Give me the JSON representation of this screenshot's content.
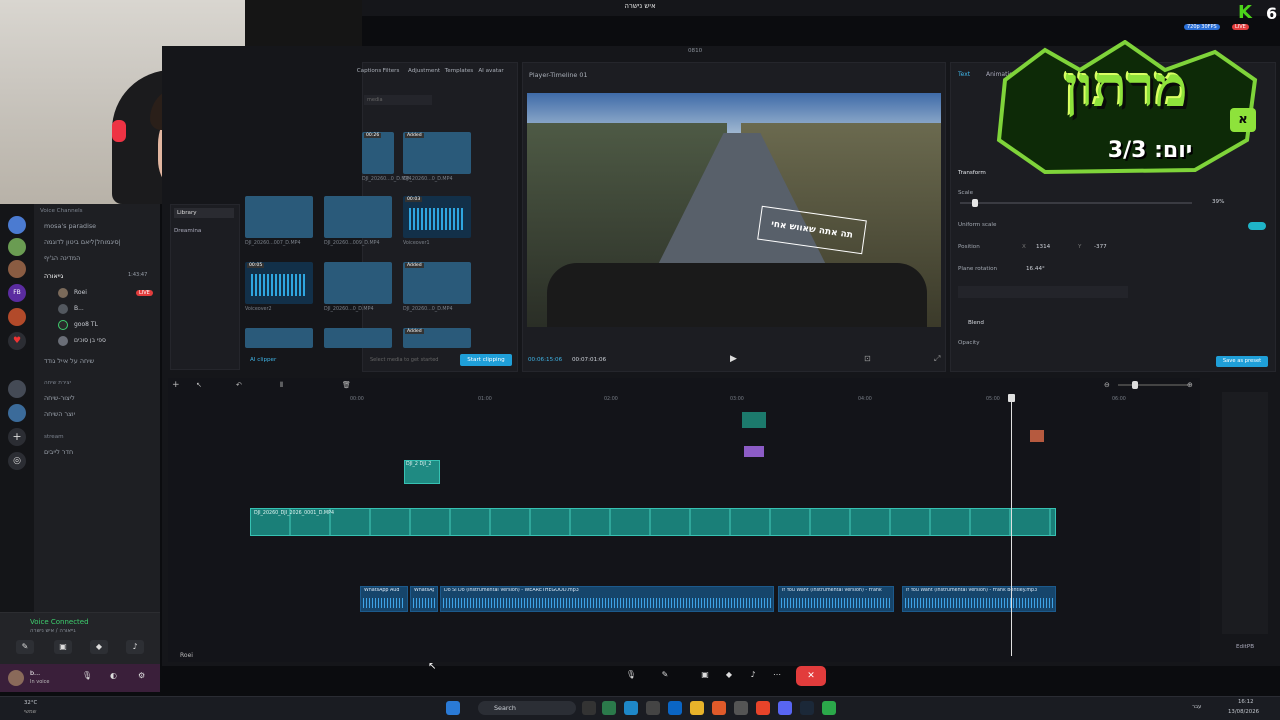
{
  "window": {
    "title": "איש נישרה"
  },
  "stream": {
    "k_label": "K",
    "count": "6",
    "quality": "720p 30FPS",
    "live": "LIVE"
  },
  "logo": {
    "title": "מרתון",
    "day": "3/3 :יום",
    "badge": "א"
  },
  "discord": {
    "section_voice": "Voice Channels",
    "channels": [
      {
        "label": "mosa's paradise"
      },
      {
        "label": "סיגמוחל|ליאם ביטון לדוגמה|"
      },
      {
        "label": "המדינה הג'יף"
      },
      {
        "label": "גייאורה",
        "selected": true,
        "time": "1:43:47"
      }
    ],
    "users": [
      {
        "name": "Roei",
        "live": "LIVE"
      },
      {
        "name": "B..."
      },
      {
        "name": "goo8 TL"
      },
      {
        "name": "ספי בן סוכים"
      }
    ],
    "extra_channel": "שיחה על אייל גודד",
    "section_create": "יצירת שיחה",
    "create_items": [
      "ליצור-שיחה",
      "יוצר השיחה"
    ],
    "section_stream": "stream",
    "stream_item": "חדר לייבים",
    "voice_connected": "Voice Connected",
    "voice_sub": "גייאורה / איש נישרה",
    "user_name": "b...",
    "user_status": "In voice"
  },
  "editor": {
    "project_name": "0810",
    "tools": [
      "Captions",
      "Filters",
      "Adjustment",
      "Templates",
      "AI avatar"
    ],
    "media_search": "media",
    "library": [
      "Library",
      "Dreamina"
    ],
    "media_items": [
      {
        "label": "DJI_20260...0_D.MP4",
        "badge": "00:26"
      },
      {
        "label": "DJI_20260...0_D.MP4",
        "badge": "Added"
      },
      {
        "label": "DJI_20260...007_D.MP4",
        "badge": ""
      },
      {
        "label": "DJI_20260...009_D.MP4",
        "badge": ""
      },
      {
        "label": "Voiceover1",
        "badge": "00:03"
      },
      {
        "label": "Voiceover2",
        "badge": "00:05"
      },
      {
        "label": "DJI_20260...0_D.MP4",
        "badge": ""
      },
      {
        "label": "DJI_20260...0_D.MP4",
        "badge": "Added"
      },
      {
        "label": "",
        "badge": ""
      },
      {
        "label": "",
        "badge": ""
      },
      {
        "label": "",
        "badge": "Added"
      }
    ],
    "ai_clipper": "AI clipper",
    "start_clipping": "Start clipping",
    "select_hint": "Select media to get started",
    "player_title": "Player-Timeline 01",
    "overlay_text": "תה אתה שאווש אחי",
    "time_current": "00:06:15:06",
    "time_total": "00:07:01:06",
    "props": {
      "tabs": [
        "Text",
        "Animation"
      ],
      "transform": "Transform",
      "scale": "Scale",
      "scale_value": "39%",
      "uniform": "Uniform scale",
      "position": "Position",
      "pos_x_label": "X",
      "pos_x": "1314",
      "pos_y_label": "Y",
      "pos_y": "-377",
      "rotation": "Plane rotation",
      "rotation_value": "16.44°",
      "blend": "Blend",
      "opacity": "Opacity",
      "save_preset": "Save as preset"
    },
    "ruler": [
      "00:00",
      "01:00",
      "02:00",
      "03:00",
      "04:00",
      "05:00",
      "06:00",
      "07:00"
    ],
    "audio_clips": [
      {
        "label": "WhatsApp Aud"
      },
      {
        "label": "WhatsApp A"
      },
      {
        "label": "Do Si Do (Instrumental Version) - WEARETHEGOOD.mp3"
      },
      {
        "label": "If You Want (Instrumental Version) - Frank"
      },
      {
        "label": "If You Want (Instrumental Version) - Frank Bentley.mp3"
      }
    ],
    "video_clip_label": "DJI_20260_DJI_2026_0001_D.MP4",
    "small_clip": "DJI_2 DJI_2",
    "editor_tag": "EditPB",
    "bottom_user": "Roei"
  },
  "taskbar": {
    "weather": "32°C",
    "weather_sub": "שמשי",
    "search": "Search",
    "lang": "עבר",
    "time": "16:12",
    "date": "13/08/2026"
  }
}
